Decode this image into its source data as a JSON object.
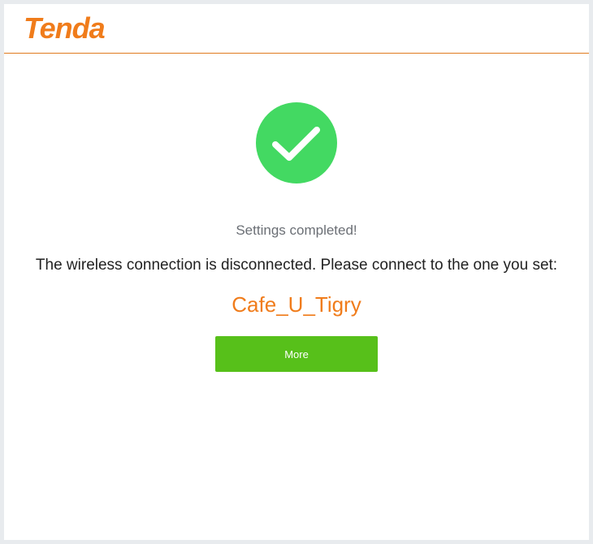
{
  "header": {
    "logo_text": "Tenda",
    "brand_color": "#f07c1b"
  },
  "result": {
    "icon": "checkmark-circle-icon",
    "icon_color": "#43d962",
    "status_text": "Settings completed!",
    "message": "The wireless connection is disconnected. Please connect to the one you set:",
    "ssid": "Cafe_U_Tigry"
  },
  "actions": {
    "more_label": "More",
    "button_color": "#57c01a"
  }
}
